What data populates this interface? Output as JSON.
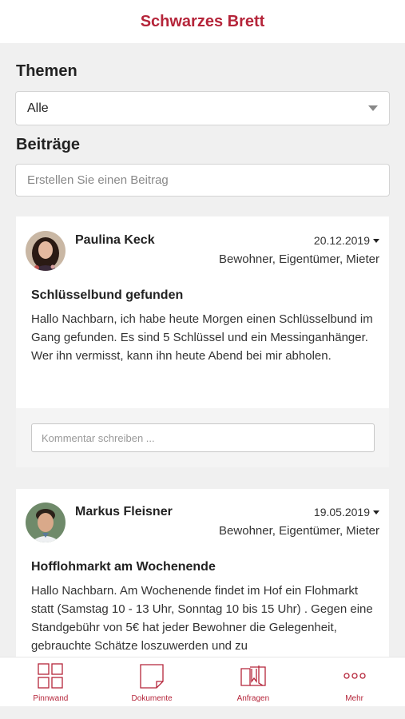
{
  "header": {
    "title": "Schwarzes Brett"
  },
  "themes": {
    "heading": "Themen",
    "selected": "Alle"
  },
  "posts_section": {
    "heading": "Beiträge",
    "create_placeholder": "Erstellen Sie einen Beitrag"
  },
  "posts": [
    {
      "author": "Paulina Keck",
      "date": "20.12.2019",
      "roles": "Bewohner, Eigentümer, Mieter",
      "title": "Schlüsselbund gefunden",
      "body": "Hallo Nachbarn, ich habe heute Morgen einen Schlüsselbund im Gang gefunden. Es sind 5 Schlüssel und ein Messinganhänger. Wer ihn vermisst, kann ihn heute Abend bei mir abholen.",
      "comment_placeholder": "Kommentar schreiben ..."
    },
    {
      "author": "Markus Fleisner",
      "date": "19.05.2019",
      "roles": "Bewohner, Eigentümer, Mieter",
      "title": "Hofflohmarkt am Wochenende",
      "body": "Hallo Nachbarn. Am Wochenende findet im Hof ein Flohmarkt statt (Samstag 10 - 13 Uhr, Sonntag 10 bis 15 Uhr) . Gegen eine Standgebühr von 5€ hat jeder Bewohner die Gelegenheit, gebrauchte Schätze loszuwerden und zu"
    }
  ],
  "tabbar": [
    {
      "label": "Pinnwand",
      "icon": "grid-icon"
    },
    {
      "label": "Dokumente",
      "icon": "document-icon"
    },
    {
      "label": "Anfragen",
      "icon": "requests-icon"
    },
    {
      "label": "Mehr",
      "icon": "more-icon"
    }
  ],
  "colors": {
    "accent": "#b5253a",
    "background": "#f0f0f0"
  }
}
